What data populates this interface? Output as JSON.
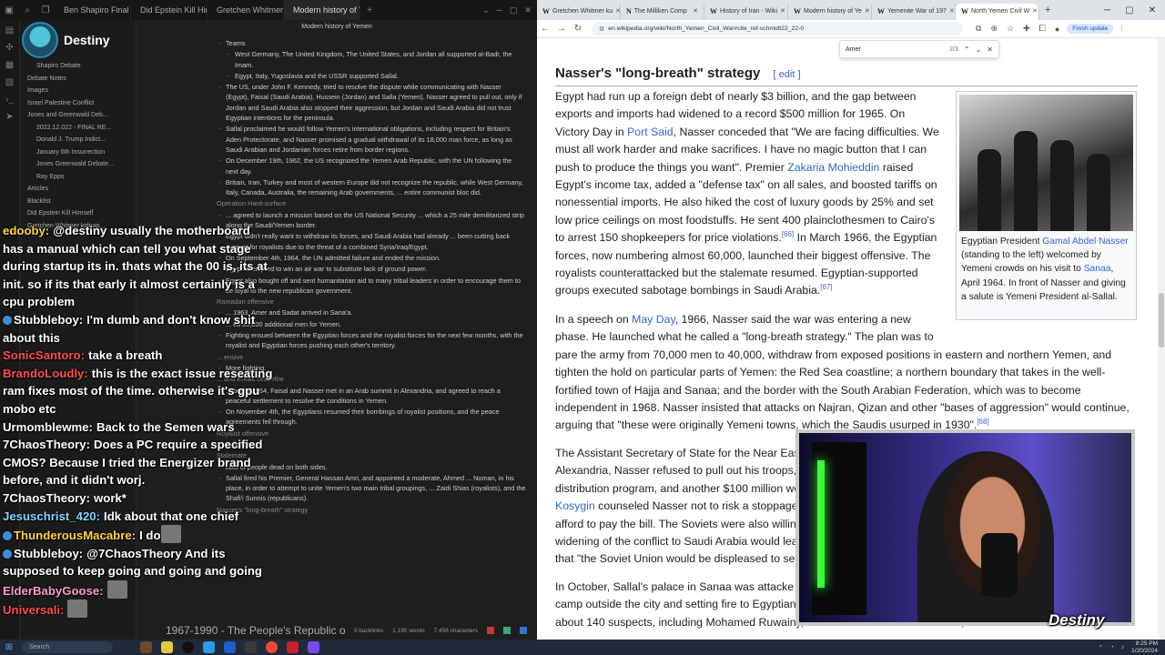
{
  "obsidian": {
    "tabs": [
      "Ben Shapiro Final Debat...",
      "Did Epstein Kill Himself",
      "Gretchen Whitmer kidna...",
      "Modern history of Ye..."
    ],
    "active_tab": 3,
    "note_title": "Modern history of Yemen",
    "profile_name": "Destiny",
    "sidebar": [
      {
        "label": "Shapiro Debate",
        "level": 2
      },
      {
        "label": "Debate Notes",
        "level": 1
      },
      {
        "label": "Images",
        "level": 1
      },
      {
        "label": "Israel Palestine Conflict",
        "level": 1
      },
      {
        "label": "Jones and Greenwald Deb...",
        "level": 1
      },
      {
        "label": "2022.12.022 - FINAL RE...",
        "level": 2
      },
      {
        "label": "Donald J. Trump Indict...",
        "level": 2
      },
      {
        "label": "January 6th Insurrection",
        "level": 2
      },
      {
        "label": "Jones Greenwald Debate...",
        "level": 2
      },
      {
        "label": "Ray Epps",
        "level": 2
      },
      {
        "label": "Articles",
        "level": 1
      },
      {
        "label": "Blacklist",
        "level": 1
      },
      {
        "label": "Did Epstein Kill Himself",
        "level": 1
      },
      {
        "label": "Gretchen Whitmer kidnap...",
        "level": 1
      }
    ],
    "body": [
      {
        "text": "Teams",
        "level": 0
      },
      {
        "text": "West Germany, The United Kingdom, The United States, and Jordan all supported al-Badr, the Imam.",
        "level": 1
      },
      {
        "text": "Egypt, Italy, Yugoslavia and the USSR supported Sallal.",
        "level": 1
      },
      {
        "text": "The US, under John F. Kennedy, tried to resolve the dispute while communicating with Nasser (Egypt), Faisal (Saudi Arabia), Hussein (Jordan) and Salla (Yemen). Nasser agreed to pull out, only if Jordan and Saudi Arabia also stopped their aggression, but Jordan and Saudi Arabia did not trust Egyptian intentions for the peninsula.",
        "level": 0
      },
      {
        "text": "Sallal proclaimed he would follow Yemen's international obligations, including respect for Britain's Aden Protectorate, and Nasser promised a gradual withdrawal of its 18,000 man force, as long as Saudi Arabian and Jordanian forces retire from border regions.",
        "level": 0
      },
      {
        "text": "On December 19th, 1962, the US recognized the Yemen Arab Republic, with the UN following the next day.",
        "level": 0
      },
      {
        "text": "Britain, Iran, Turkey and most of western Europe did not recognize the republic, while West Germany, Italy, Canada, Australia, the remaining Arab governments, ... entire communist bloc did.",
        "level": 0
      },
      {
        "text": "Operation Hard-surface",
        "level": -1
      },
      {
        "text": "... agreed to launch a mission based on the US National Security ... which a 25 mile demilitarized strip along the Saudi/Yemen border.",
        "level": 0
      },
      {
        "text": "Egypt didn't really want to withdraw its forces, and Saudi Arabia had already ... been cutting back support for royalists due to the threat of a combined Syria/Iraq/Egypt.",
        "level": 0
      },
      {
        "text": "On September 4th, 1964, the UN admitted failure and ended the mission.",
        "level": 0
      },
      {
        "text": "Egypt attempted to win an air war to substitute lack of ground power.",
        "level": 0
      },
      {
        "text": "Egypt also bought off and sent humanitarian aid to many tribal leaders in order to encourage them to be loyal to the new republican government.",
        "level": 0
      },
      {
        "text": "Ramadan offensive",
        "level": -1
      },
      {
        "text": "... 1963, Amer and Sadat arrived in Sana'a.",
        "level": 0
      },
      {
        "text": "... ed 20,000 additional men for Yemen.",
        "level": 0
      },
      {
        "text": "Fighting ensued between the Egyptian forces and the royalist forces for the next few months, with the royalist and Egyptian forces pushing each other's territory.",
        "level": 0
      },
      {
        "text": "... ensive",
        "level": -1
      },
      {
        "text": "More fighting.",
        "level": 0
      },
      {
        "text": "... and Erkwit ceasefire",
        "level": -1
      },
      {
        "text": "... ber of 1964, Faisal and Nasser met in an Arab summit in Alexandria, and agreed to reach a peaceful settlement to resolve the conditions in Yemen.",
        "level": 0
      },
      {
        "text": "On November 4th, the Egyptians resumed their bombings of royalist positions, and the peace agreements fell through.",
        "level": 0
      },
      {
        "text": "Royalist offensive",
        "level": -1
      },
      {
        "text": "... fighting.",
        "level": 0
      },
      {
        "text": "Stalemate",
        "level": -1
      },
      {
        "text": "Lots of people dead on both sides.",
        "level": 0
      },
      {
        "text": "Sallal fired his Premier, General Hassan Amri, and appointed a moderate, Ahmed ... Noman, in his place, in order to attempt to unite Yemen's two main tribal groupings, ... Zaidi Shias (royalists), and the Shafi'i Sunnis (republicans).",
        "level": 0
      },
      {
        "text": "Nasser's \"long-breath\" strategy",
        "level": -1
      }
    ],
    "bottom_title": "1967-1990 - The People's Republic o",
    "status": {
      "backlinks": "0 backlinks",
      "words": "1,195 words",
      "chars": "7,456 characters"
    }
  },
  "chat": [
    {
      "user": "edooby",
      "color": "#ffd23f",
      "text": "@destiny usually the motherboard has a manual which can tell you what stage during startup its in. thats what the 00 is, its at init. so if its that early it almost certainly is a cpu problem",
      "badge": false
    },
    {
      "user": "Stubbleboy",
      "color": "#ffffff",
      "text": "I'm dumb and don't know shit about this",
      "badge": true
    },
    {
      "user": "SonicSantoro",
      "color": "#ff4d4d",
      "text": "take a breath",
      "badge": false
    },
    {
      "user": "BrandoLoudly",
      "color": "#ff4d4d",
      "text": "this is the exact issue reseating ram fixes most of the time. otherwise it's gpu mobo etc",
      "badge": false
    },
    {
      "user": "Urmomblewme",
      "color": "#ffffff",
      "text": "Back to the Semen wars",
      "badge": false
    },
    {
      "user": "7ChaosTheory",
      "color": "#ffffff",
      "text": "Does a PC require a specified CMOS? Because I tried the Energizer brand before, and it didn't worj.",
      "badge": false
    },
    {
      "user": "7ChaosTheory",
      "color": "#ffffff",
      "text": "work*",
      "badge": false
    },
    {
      "user": "Jesuschrist_420",
      "color": "#7fd4ff",
      "text": "Idk about that one chief",
      "badge": false
    },
    {
      "user": "ThunderousMacabre",
      "color": "#ffd23f",
      "text": "I do",
      "badge": true,
      "emote": true
    },
    {
      "user": "Stubbleboy",
      "color": "#ffffff",
      "text": "@7ChaosTheory And its supposed to keep going and going and going",
      "badge": true,
      "emote_line": true
    },
    {
      "user": "ElderBabyGoose",
      "color": "#ff9bd0",
      "text": "",
      "badge": false,
      "emote": true
    },
    {
      "user": "Universali",
      "color": "#ff4d4d",
      "text": "",
      "badge": false,
      "emote": true
    }
  ],
  "browser": {
    "tabs": [
      {
        "fav": "W",
        "label": "Gretchen Whitmer ku"
      },
      {
        "fav": "N",
        "label": "The Milliken Comp"
      },
      {
        "fav": "W",
        "label": "History of Iran - Wiki"
      },
      {
        "fav": "W",
        "label": "Modern history of Ye"
      },
      {
        "fav": "W",
        "label": "Yemenite War of 197"
      },
      {
        "fav": "W",
        "label": "North Yemen Civil W"
      }
    ],
    "active_tab": 5,
    "url": "en.wikipedia.org/wiki/North_Yemen_Civil_War#cite_ref-schmidt22_22-0",
    "finish_update": "Finish update",
    "find": {
      "query": "Amer",
      "count": "2/3"
    }
  },
  "article": {
    "heading": "Nasser's \"long-breath\" strategy",
    "edit_label": "edit",
    "caption_parts": [
      "Egyptian President ",
      "Gamal Abdel Nasser",
      " (standing to the left) welcomed by Yemeni crowds on his visit to ",
      "Sanaa",
      ", April 1964. In front of Nasser and giving a salute is Yemeni President al-Sallal."
    ],
    "p1": [
      "Egypt had run up a foreign debt of nearly $3 billion, and the gap between",
      "exports and imports had widened to a record $500 million for 1965. On",
      "Victory Day in ",
      "Port Said",
      ", Nasser conceded that \"We are facing difficulties. We",
      "must all work harder and make sacrifices. I have no magic button that I can",
      "push to produce the things you want\". Premier ",
      "Zakaria Mohieddin",
      " raised",
      "Egypt's income tax, added a \"defense tax\" on all sales, and boosted tariffs on",
      "nonessential imports. He also hiked the cost of luxury goods by 25% and set",
      "low price ceilings on most foodstuffs. He sent 400 plainclothesmen to Cairo's",
      "to arrest 150 shopkeepers for price violations.",
      "[66]",
      " In March 1966, the Egyptian",
      "forces, now numbering almost 60,000, launched their biggest offensive. The",
      "royalists counterattacked but the stalemate resumed. Egyptian-supported",
      "groups executed sabotage bombings in Saudi Arabia.",
      "[67]"
    ],
    "p2": [
      "In a speech on ",
      "May Day",
      ", 1966, Nasser said the war was entering a new",
      "phase. He launched what he called a \"long-breath strategy.\" The plan was to",
      "pare the army from 70,000 men to 40,000, withdraw from exposed positions in eastern and northern Yemen, and",
      "tighten the hold on particular parts of Yemen: the Red Sea coastline; a northern boundary that takes in the well-",
      "fortified town of Hajja and Sanaa; and the border with the South Arabian Federation, which was to become",
      "independent in 1968. Nasser insisted that attacks on Najran, Qizan and other \"bases of aggression\" would continue,",
      "arguing that \"these were originally Yemeni towns, which the Saudis usurped in 1930\".",
      "[68]"
    ],
    "p3": [
      "The Assistant Secretary of State for the Near Eas",
      "Alexandria, Nasser refused to pull out his troops,",
      "distribution program, and another $100 million wo",
      "Kosygin",
      " counseled Nasser not to risk a stoppage",
      "afford to pay the bill. The Soviets were also willin",
      "widening of the conflict to Saudi Arabia would lea",
      "that \"the Soviet Union would be displeased to see"
    ],
    "p4": [
      "In October, Sallal's palace in Sanaa was attacke",
      "camp outside the city and setting fire to Egyptian",
      "about 140 suspects, including Mohamed Ruwainy, the ex-Minister for Tribal Affairs, and Colonel Had"
    ]
  },
  "overlay": {
    "cam_logo": "Destiny"
  },
  "taskbar": {
    "search": "Search",
    "time": "8:25 PM",
    "date": "1/20/2024"
  }
}
